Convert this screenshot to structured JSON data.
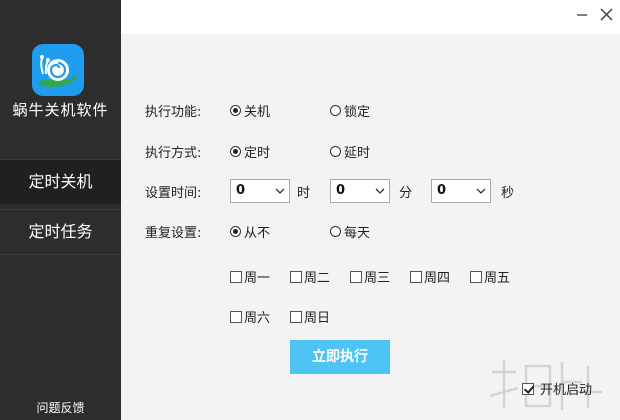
{
  "app": {
    "name": "蜗牛关机软件"
  },
  "sidebar": {
    "items": [
      {
        "label": "定时关机",
        "active": true
      },
      {
        "label": "定时任务",
        "active": false
      }
    ],
    "feedback": "问题反馈"
  },
  "window": {
    "minimize_icon": "minimize-icon",
    "close_icon": "close-icon"
  },
  "form": {
    "function": {
      "label": "执行功能:",
      "options": [
        {
          "label": "关机",
          "checked": true
        },
        {
          "label": "锁定",
          "checked": false
        }
      ]
    },
    "mode": {
      "label": "执行方式:",
      "options": [
        {
          "label": "定时",
          "checked": true
        },
        {
          "label": "延时",
          "checked": false
        }
      ]
    },
    "time": {
      "label": "设置时间:",
      "hour": {
        "value": "0",
        "unit": "时"
      },
      "minute": {
        "value": "0",
        "unit": "分"
      },
      "second": {
        "value": "0",
        "unit": "秒"
      }
    },
    "repeat": {
      "label": "重复设置:",
      "options": [
        {
          "label": "从不",
          "checked": true
        },
        {
          "label": "每天",
          "checked": false
        }
      ],
      "days": [
        {
          "label": "周一",
          "checked": false
        },
        {
          "label": "周二",
          "checked": false
        },
        {
          "label": "周三",
          "checked": false
        },
        {
          "label": "周四",
          "checked": false
        },
        {
          "label": "周五",
          "checked": false
        },
        {
          "label": "周六",
          "checked": false
        },
        {
          "label": "周日",
          "checked": false
        }
      ]
    },
    "execute_label": "立即执行",
    "autostart": {
      "label": "开机启动",
      "checked": true
    }
  },
  "colors": {
    "sidebar": "#2d2d2d",
    "accent": "#4ec4f5",
    "logo": "#1f9bf0"
  }
}
